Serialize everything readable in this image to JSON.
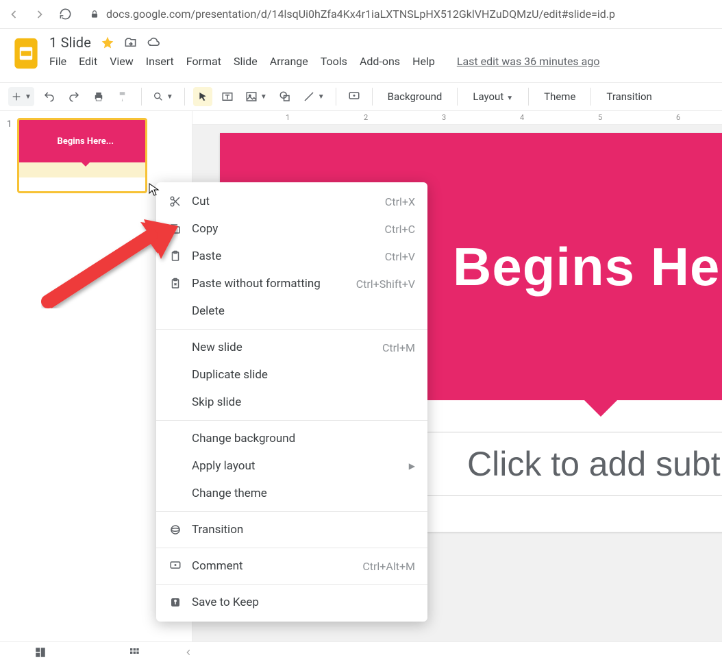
{
  "browser": {
    "url": "docs.google.com/presentation/d/14lsqUi0hZfa4Kx4r1iaLXTNSLpHX512GklVHZuDQMzU/edit#slide=id.p"
  },
  "doc": {
    "title": "1 Slide",
    "last_edit": "Last edit was 36 minutes ago"
  },
  "menu": {
    "items": [
      "File",
      "Edit",
      "View",
      "Insert",
      "Format",
      "Slide",
      "Arrange",
      "Tools",
      "Add-ons",
      "Help"
    ]
  },
  "toolbar": {
    "background": "Background",
    "layout": "Layout",
    "theme": "Theme",
    "transition": "Transition"
  },
  "ruler": {
    "ticks": [
      "1",
      "2",
      "3",
      "4",
      "5",
      "6"
    ]
  },
  "thumbnail": {
    "number": "1",
    "title": "Begins Here..."
  },
  "slide": {
    "title": "Begins Here",
    "subtitle": "Click to add subtit"
  },
  "context_menu": {
    "items": [
      {
        "icon": "scissors",
        "label": "Cut",
        "shortcut": "Ctrl+X",
        "indent": false
      },
      {
        "icon": "copy",
        "label": "Copy",
        "shortcut": "Ctrl+C",
        "indent": false
      },
      {
        "icon": "clipboard",
        "label": "Paste",
        "shortcut": "Ctrl+V",
        "indent": false
      },
      {
        "icon": "clipboard-x",
        "label": "Paste without formatting",
        "shortcut": "Ctrl+Shift+V",
        "indent": false
      },
      {
        "icon": "",
        "label": "Delete",
        "shortcut": "",
        "indent": true
      },
      {
        "divider": true
      },
      {
        "icon": "",
        "label": "New slide",
        "shortcut": "Ctrl+M",
        "indent": true
      },
      {
        "icon": "",
        "label": "Duplicate slide",
        "shortcut": "",
        "indent": true
      },
      {
        "icon": "",
        "label": "Skip slide",
        "shortcut": "",
        "indent": true
      },
      {
        "divider": true
      },
      {
        "icon": "",
        "label": "Change background",
        "shortcut": "",
        "indent": true
      },
      {
        "icon": "",
        "label": "Apply layout",
        "shortcut": "",
        "submenu": true,
        "indent": true
      },
      {
        "icon": "",
        "label": "Change theme",
        "shortcut": "",
        "indent": true
      },
      {
        "divider": true
      },
      {
        "icon": "transition",
        "label": "Transition",
        "shortcut": "",
        "indent": false
      },
      {
        "divider": true
      },
      {
        "icon": "comment",
        "label": "Comment",
        "shortcut": "Ctrl+Alt+M",
        "indent": false
      },
      {
        "divider": true
      },
      {
        "icon": "keep",
        "label": "Save to Keep",
        "shortcut": "",
        "indent": false
      }
    ]
  }
}
